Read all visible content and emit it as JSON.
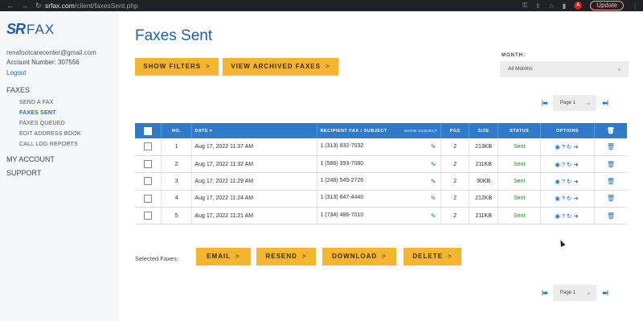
{
  "browser": {
    "url_domain": "srfax.com",
    "url_path": "/client/faxesSent.php",
    "avatar_letter": "A",
    "update_label": "Update"
  },
  "sidebar": {
    "logo_sr": "SR",
    "logo_fax": "FAX",
    "email": "renafootcarecenter@gmail.com",
    "account": "Account Number: 307556",
    "logout": "Logout",
    "faxes_header": "FAXES",
    "faxes_items": [
      {
        "label": "SEND A FAX",
        "active": false
      },
      {
        "label": "FAXES SENT",
        "active": true
      },
      {
        "label": "FAXES QUEUED",
        "active": false
      },
      {
        "label": "EDIT ADDRESS BOOK",
        "active": false
      },
      {
        "label": "CALL LOG REPORTS",
        "active": false
      }
    ],
    "my_account": "MY ACCOUNT",
    "support": "SUPPORT"
  },
  "main": {
    "title": "Faxes Sent",
    "show_filters": "SHOW FILTERS",
    "view_archived": "VIEW ARCHIVED FAXES",
    "month_label": "MONTH:",
    "month_value": "All Months",
    "page_value": "Page 1",
    "selected_label": "Selected Faxes:",
    "actions": [
      "EMAIL",
      "RESEND",
      "DOWNLOAD",
      "DELETE"
    ]
  },
  "table": {
    "headers": {
      "no": "NO.",
      "date": "DATE",
      "recipient": "RECIPIENT FAX / SUBJECT",
      "show_subject": "SHOW SUBJECT",
      "pgs": "PGS",
      "size": "SIZE",
      "status": "STATUS",
      "options": "OPTIONS"
    },
    "rows": [
      {
        "no": "1",
        "date": "Aug 17, 2022 11:37 AM",
        "recipient": "1 (313) 832-7032",
        "pgs": "2",
        "size": "213KB",
        "status": "Sent"
      },
      {
        "no": "2",
        "date": "Aug 17, 2022 11:32 AM",
        "recipient": "1 (586) 393-7080",
        "pgs": "2",
        "size": "211KB",
        "status": "Sent"
      },
      {
        "no": "3",
        "date": "Aug 17, 2022 11:29 AM",
        "recipient": "1 (248) 545-2726",
        "pgs": "2",
        "size": "90KB",
        "status": "Sent"
      },
      {
        "no": "4",
        "date": "Aug 17, 2022 11:24 AM",
        "recipient": "1 (313) 647-4440",
        "pgs": "2",
        "size": "212KB",
        "status": "Sent"
      },
      {
        "no": "5",
        "date": "Aug 17, 2022 11:21 AM",
        "recipient": "1 (734) 486-7010",
        "pgs": "2",
        "size": "211KB",
        "status": "Sent"
      }
    ]
  },
  "colors": {
    "accent": "#2f7bc9",
    "button": "#f5b52e",
    "status_sent": "#2d8a2d"
  }
}
